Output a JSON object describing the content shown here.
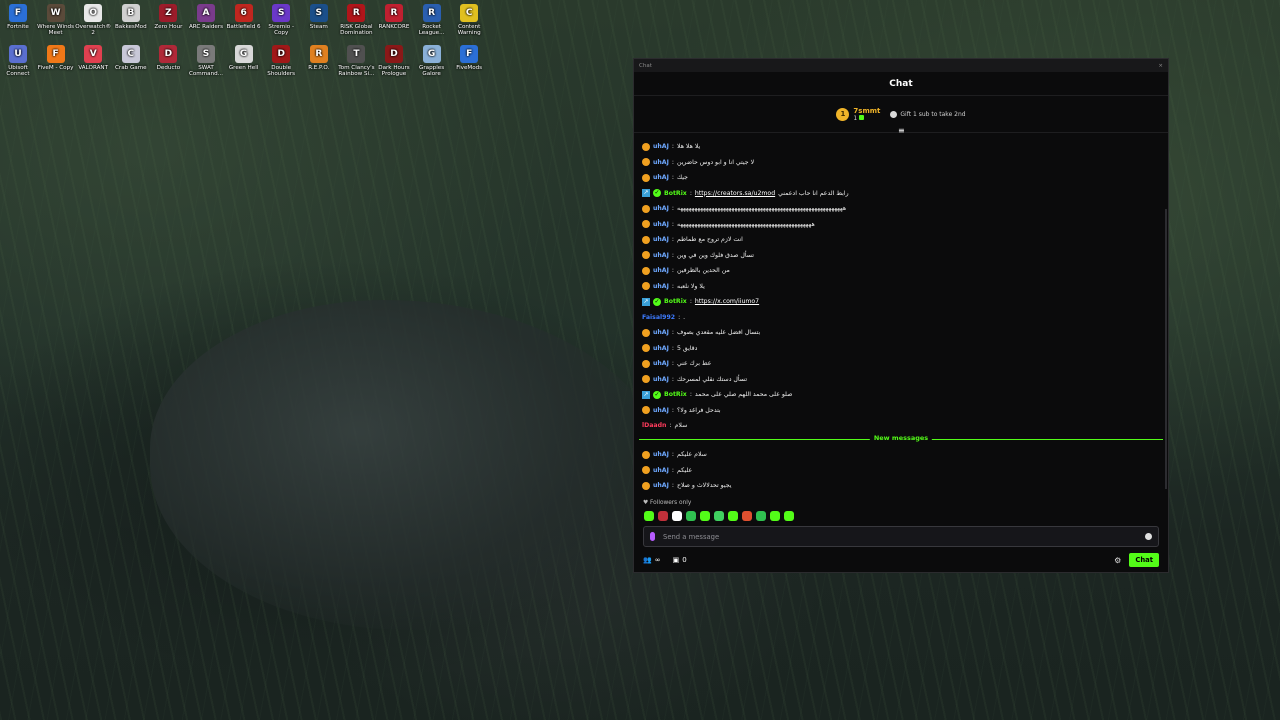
{
  "desktop": {
    "icons": [
      {
        "label": "Fortnite",
        "color": "#2b6fd6",
        "glyph": "F"
      },
      {
        "label": "Where Winds Meet",
        "color": "#5a4a3a",
        "glyph": "W"
      },
      {
        "label": "Overwatch® 2",
        "color": "#e8e8e8",
        "glyph": "O"
      },
      {
        "label": "BakkesMod",
        "color": "#d0d0d0",
        "glyph": "B"
      },
      {
        "label": "Zero Hour",
        "color": "#9c1c2a",
        "glyph": "Z"
      },
      {
        "label": "ARC Raiders",
        "color": "#7a3b8c",
        "glyph": "A"
      },
      {
        "label": "Battlefield 6",
        "color": "#c0261f",
        "glyph": "6"
      },
      {
        "label": "Stremio - Copy",
        "color": "#6a38c8",
        "glyph": "S"
      },
      {
        "label": "Steam",
        "color": "#1b4f8a",
        "glyph": "S"
      },
      {
        "label": "RISK Global Domination",
        "color": "#b0151a",
        "glyph": "R"
      },
      {
        "label": "RANKCORE",
        "color": "#c02030",
        "glyph": "R"
      },
      {
        "label": "Rocket League...",
        "color": "#2a5fb0",
        "glyph": "R"
      },
      {
        "label": "Content Warning",
        "color": "#e0c020",
        "glyph": "C"
      },
      {
        "label": "Ubisoft Connect",
        "color": "#5a6fd0",
        "glyph": "U"
      },
      {
        "label": "FiveM - Copy",
        "color": "#f07818",
        "glyph": "F"
      },
      {
        "label": "VALORANT",
        "color": "#e04050",
        "glyph": "V"
      },
      {
        "label": "Crab Game",
        "color": "#c8c8d8",
        "glyph": "C"
      },
      {
        "label": "Deducto",
        "color": "#b02838",
        "glyph": "D"
      },
      {
        "label": "SWAT Command...",
        "color": "#7a7a7a",
        "glyph": "S"
      },
      {
        "label": "Green Hell",
        "color": "#d8d8d8",
        "glyph": "G"
      },
      {
        "label": "Double Shoulders",
        "color": "#a01818",
        "glyph": "D"
      },
      {
        "label": "R.E.P.O.",
        "color": "#e08020",
        "glyph": "R"
      },
      {
        "label": "Tom Clancy's Rainbow Si...",
        "color": "#505050",
        "glyph": "T"
      },
      {
        "label": "Dark Hours Prologue",
        "color": "#8a1818",
        "glyph": "D"
      },
      {
        "label": "Grapples Galore",
        "color": "#8ab0d8",
        "glyph": "G"
      },
      {
        "label": "FiveMods",
        "color": "#2b6fd6",
        "glyph": "F"
      }
    ]
  },
  "window": {
    "title": "Chat",
    "close": "×"
  },
  "chat": {
    "header": "Chat",
    "gift_bar": {
      "rank": "1",
      "name": "7smmt",
      "count": "1",
      "cta": "Gift 1 sub to take 2nd"
    },
    "messages": [
      {
        "user": "uhAJ",
        "type": "sub",
        "text": "يلا هلا هلا"
      },
      {
        "user": "uhAJ",
        "type": "sub",
        "text": "لا جيتي انا و ابو دوس حاضرين"
      },
      {
        "user": "uhAJ",
        "type": "sub",
        "text": "جيك"
      },
      {
        "user": "BotRix",
        "type": "bot",
        "prefix": "رابط الدعم انا حاب ادعمني",
        "link": "https://creators.sa/u2mod"
      },
      {
        "user": "uhAJ",
        "type": "sub",
        "text": "ههههههههههههههههههههههههههههههههههههههههههههههههههههههههههه"
      },
      {
        "user": "uhAJ",
        "type": "sub",
        "text": "هههههههههههههههههههههههههههههههههههههههههههههههه"
      },
      {
        "user": "uhAJ",
        "type": "sub",
        "text": "انت لازم تروح مع طماطم"
      },
      {
        "user": "uhAJ",
        "type": "sub",
        "text": "تسأل صدق فلوك وين في وين"
      },
      {
        "user": "uhAJ",
        "type": "sub",
        "text": "من الحدين بالظرفين"
      },
      {
        "user": "uhAJ",
        "type": "sub",
        "text": "يلا ولا نلعبه"
      },
      {
        "user": "BotRix",
        "type": "bot",
        "prefix": "",
        "link": "https://x.com/iiumo7"
      },
      {
        "user": "Faisal992",
        "type": "plain",
        "text": "."
      },
      {
        "user": "uhAJ",
        "type": "sub",
        "text": "بتسال افضل عليه مقعدي بصوف"
      },
      {
        "user": "uhAJ",
        "type": "sub",
        "text": "دقايق 5"
      },
      {
        "user": "uhAJ",
        "type": "sub",
        "text": "عط برك عني"
      },
      {
        "user": "uhAJ",
        "type": "sub",
        "text": "تسأل دستك نقلي لمسرحك"
      },
      {
        "user": "BotRix",
        "type": "bot",
        "prefix": "",
        "text": "صلو على محمد اللهم صلي على محمد"
      },
      {
        "user": "uhAJ",
        "type": "sub",
        "text": "بتدحل فراغد ولا؟"
      },
      {
        "user": "lDaadn",
        "type": "red",
        "text": "سلام"
      }
    ],
    "new_messages_label": "New messages",
    "new_messages": [
      {
        "user": "uhAJ",
        "type": "sub",
        "text": "سلام عليكم"
      },
      {
        "user": "uhAJ",
        "type": "sub",
        "text": "عليكم"
      },
      {
        "user": "uhAJ",
        "type": "sub",
        "text": "يجيو تحدلالاث و صلاح"
      }
    ],
    "followers_only": "Followers only",
    "emote_colors": [
      "#53fc18",
      "#c0303a",
      "#ffffff",
      "#30c050",
      "#53fc18",
      "#40d060",
      "#53fc18",
      "#e05030",
      "#30c050",
      "#53fc18",
      "#53fc18"
    ],
    "input_placeholder": "Send a message",
    "footer": {
      "viewers_label": "∞",
      "points": "0",
      "chat_button": "Chat"
    }
  }
}
